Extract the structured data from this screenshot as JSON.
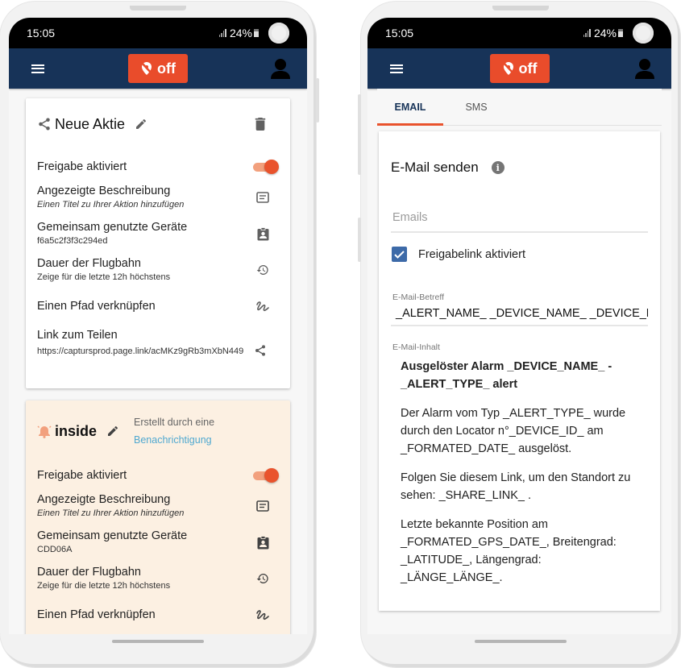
{
  "status_bar": {
    "time": "15:05",
    "battery": "24%"
  },
  "app_bar": {
    "tracking_button_label": "off",
    "accent": "#e94c2b",
    "bar_color": "#173358"
  },
  "left_screen": {
    "cards": [
      {
        "title": "Neue Aktie",
        "toggle_label": "Freigabe aktiviert",
        "toggle_on": true,
        "rows": [
          {
            "label": "Angezeigte Beschreibung",
            "sub": "Einen Titel zu Ihrer Aktion hinzufügen",
            "icon": "subject-icon"
          },
          {
            "label": "Gemeinsam genutzte Geräte",
            "sub": "f6a5c2f3f3c294ed",
            "icon": "badge-icon"
          },
          {
            "label": "Dauer der Flugbahn",
            "sub": "Zeige für die letzte 12h höchstens",
            "icon": "history-icon"
          },
          {
            "label": "Einen Pfad verknüpfen",
            "sub": "",
            "icon": "gesture-icon"
          },
          {
            "label": "Link zum Teilen",
            "sub": "https://captursprod.page.link/acMKz9gRb3mXbN449",
            "icon": "share-icon"
          }
        ]
      },
      {
        "title": "inside",
        "created_by": "Erstellt durch eine",
        "created_by_link": "Benachrichtigung",
        "toggle_label": "Freigabe aktiviert",
        "toggle_on": true,
        "rows": [
          {
            "label": "Angezeigte Beschreibung",
            "sub": "Einen Titel zu Ihrer Aktion hinzufügen",
            "icon": "subject-icon"
          },
          {
            "label": "Gemeinsam genutzte Geräte",
            "sub": "CDD06A",
            "icon": "badge-icon"
          },
          {
            "label": "Dauer der Flugbahn",
            "sub": "Zeige für die letzte 12h höchstens",
            "icon": "history-icon"
          },
          {
            "label": "Einen Pfad verknüpfen",
            "sub": "",
            "icon": "gesture-icon"
          }
        ]
      }
    ]
  },
  "right_screen": {
    "tabs": [
      {
        "label": "EMAIL",
        "active": true
      },
      {
        "label": "SMS",
        "active": false
      }
    ],
    "heading": "E-Mail senden",
    "emails_placeholder": "Emails",
    "emails_value": "",
    "share_link_checkbox": {
      "label": "Freigabelink aktiviert",
      "checked": true
    },
    "subject_label": "E-Mail-Betreff",
    "subject_value": "_ALERT_NAME_ _DEVICE_NAME_ _DEVICE_NAME_",
    "content_label": "E-Mail-Inhalt",
    "content": [
      "Ausgelöster Alarm _DEVICE_NAME_ - _ALERT_TYPE_ alert",
      "Der Alarm vom Typ _ALERT_TYPE_ wurde durch den Locator n°_DEVICE_ID_ am _FORMATED_DATE_ ausgelöst.",
      "Folgen Sie diesem Link, um den Standort zu sehen: _SHARE_LINK_ .",
      "Letzte bekannte Position am _FORMATED_GPS_DATE_, Breitengrad: _LATITUDE_, Längengrad: _LÄNGE_LÄNGE_."
    ]
  }
}
